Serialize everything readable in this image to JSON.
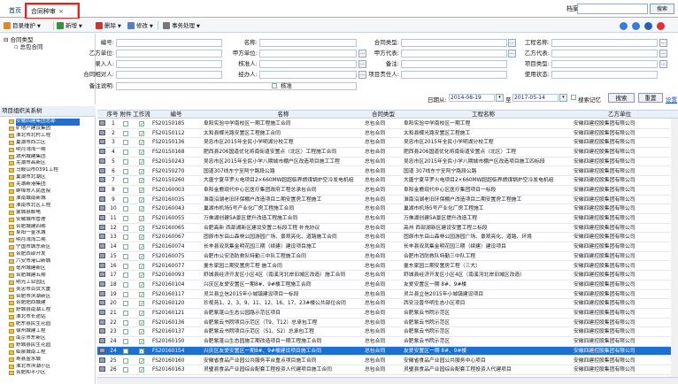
{
  "tabs": {
    "home": "首页",
    "contract": "合同种审"
  },
  "top": {
    "archive_label": "档案",
    "search_button": "搜索"
  },
  "toolbar": {
    "catalog": "目录维护",
    "add": "新增",
    "delete": "删除",
    "edit": "修改",
    "workflow": "事务处理",
    "dropdown_mark": "▼"
  },
  "tree": {
    "root": "合同类型",
    "child": "总包合同"
  },
  "form": {
    "labels": {
      "code": "编号:",
      "name": "名称:",
      "type": "合同类型:",
      "project_code": "工程名称:",
      "party_a": "乙方单位:",
      "party_a2": "甲方单位:",
      "party_a_rep": "甲方代表:",
      "party_b_rep": "乙方代表:",
      "entry": "录入人:",
      "approver": "核准人:",
      "remark": "备注:",
      "project_type": "项目类型:",
      "contract_unit": "合同相对人:",
      "handler": "经办人:",
      "project_manager": "项目责任人:",
      "use_status": "使用状态:",
      "remarks": "备注说明:",
      "approved": "核准"
    },
    "date_label": "日期从:",
    "date_from": "2014-08-19",
    "date_to_label": "至",
    "date_to": "2017-05-14",
    "remember_label": "搜索记忆",
    "search_button": "搜索",
    "reset_button": "重置",
    "settings_link": "设置"
  },
  "left_panel": {
    "header": "项目组织关系树",
    "items": [
      "安徽四建集团总部",
      "矿地产建设集团",
      "淮北市北村工程",
      "巢湖市西二区",
      "明月湾湾一期",
      "滁州城建集团",
      "芜湖市高新区",
      "马鞍山市0391工程",
      "巢湖市北湖区",
      "芜湖新港集团",
      "蚌埠市人民医院",
      "淮南城南新城",
      "淮南市北区工程",
      "蒙城县邮电",
      "安徽城市管理",
      "合肥城建四期",
      "阜阳一金水城",
      "明月湾湾二期",
      "宁国市城东新区",
      "合肥西部开发",
      "六安市港口新城",
      "亳州城建新区",
      "合肥城建五期",
      "明光工业园区",
      "吴忠市百货大厦",
      "合肥市滨湖新区",
      "合肥肥西城建",
      "舒城县南湖工程",
      "淮北市长途站",
      "肥东县民生花园",
      "宿州城建工程",
      "南京市东新区",
      "舒城县民生花园",
      "临泉城南工程",
      "寿县金水城",
      "淮北市滨湖小区",
      "合肥和平小区"
    ]
  },
  "grid": {
    "headers": [
      "序号",
      "附件",
      "工作流",
      "编号",
      "名称",
      "合同类型",
      "工程名称",
      "乙方单位"
    ],
    "rows": [
      {
        "no": "1",
        "att": false,
        "wf": true,
        "code": "FS20150185",
        "name": "阜阳实验中学南校区一期工程施工合同",
        "type": "总包合同",
        "project": "阜阳实验中学南校区一期工程",
        "party": "安徽四建控股集团有限公司"
      },
      {
        "no": "2",
        "att": false,
        "wf": true,
        "code": "FS20150112",
        "name": "太和县蝶光路安置区工程施工合同",
        "type": "总包合同",
        "project": "太和县蝶光路安置区工程施工",
        "party": "安徽四建控股集团有限公司"
      },
      {
        "no": "3",
        "att": false,
        "wf": true,
        "code": "FS20150136",
        "name": "吴忠市区2015年全民小学明湖分校工程",
        "type": "总包合同",
        "project": "吴忠市区2015年全民小学明湖分校工程",
        "party": "安徽四建控股集团有限公司"
      },
      {
        "no": "4",
        "att": false,
        "wf": true,
        "code": "FS20150168",
        "name": "肥西县206国道优化将南街道安置点（北区）工程施工合同",
        "type": "总包合同",
        "project": "肥西县206国道优化将南街道安置点（北区）工程",
        "party": "安徽四建控股集团有限公司"
      },
      {
        "no": "5",
        "att": false,
        "wf": true,
        "code": "FS20150243",
        "name": "吴忠市区2015年全民小学八期城市棚户区改造项目施工工程",
        "type": "总包合同",
        "project": "吴忠市区2015年全民小学八期城市棚户区改造项目施工四标段",
        "party": "安徽四建控股集团有限公司"
      },
      {
        "no": "6",
        "att": false,
        "wf": true,
        "code": "FS20150270",
        "name": "国道307线东宁至阿宁路段公路",
        "type": "总包合同",
        "project": "国道 307线东宁至阿宁路段公路",
        "party": "安徽四建控股集团有限公司"
      },
      {
        "no": "7",
        "att": false,
        "wf": true,
        "code": "FS20150260",
        "name": "大唐宁夏平罗火电项目2×660MW超超临界燃煤锅炉空冷发电机组",
        "type": "总包合同",
        "project": "大唐宁夏平罗火电项目2×660MW超超临界燃煤锅炉空冷发电机组",
        "party": "安徽四建控股集团有限公司"
      },
      {
        "no": "8",
        "att": false,
        "wf": true,
        "code": "FS20160003",
        "name": "阜阳金鹿现代中心区医疗集团政府工程总承包合同",
        "type": "总包合同",
        "project": "阜阳金鹿现代中心区医疗集团项目一标段",
        "party": "安徽四建控股集团有限公司"
      },
      {
        "no": "9",
        "att": false,
        "wf": true,
        "code": "FS20160035",
        "name": "淮南沿湖老旧环保棚户改造项目二期安置房工程施工",
        "type": "总包合同",
        "project": "淮南沿湖老旧环保棚户改造项目二期安置房工程施工",
        "party": "安徽四建控股集团有限公司"
      },
      {
        "no": "10",
        "att": false,
        "wf": true,
        "code": "FS20160043",
        "name": "巢湖市机场5号产业化厂房工程施工合同",
        "type": "总包合同",
        "project": "巢湖市机场5号产业化厂房工程施工",
        "party": "安徽四建控股集团有限公司"
      },
      {
        "no": "11",
        "att": false,
        "wf": true,
        "code": "FS20160055",
        "name": "万佛湖创建5A景区提升改造工程施工合同",
        "type": "总包合同",
        "project": "万佛湖创建5A景区提升改造工程",
        "party": "安徽四建控股集团有限公司"
      },
      {
        "no": "12",
        "att": false,
        "wf": true,
        "code": "FS20160065",
        "name": "合肥高新 西部湖新区建设安置二标段工程 补充协议",
        "type": "总包合同",
        "project": "高州 西部湖新区建设安置工程二标段",
        "party": "安徽四建控股集团有限公司"
      },
      {
        "no": "13",
        "att": false,
        "wf": true,
        "code": "FS20160067",
        "name": "固原市东岳山森林公园游园广场、景观亮化、道路施工合同",
        "type": "总包合同",
        "project": "固原市东岳山森林公园游园广场、景观亮化、道路、环境",
        "party": "安徽四建控股集团有限公司"
      },
      {
        "no": "14",
        "att": false,
        "wf": true,
        "code": "FS20160074",
        "name": "长丰县双凤集金明花园三期（续建）建设项目施工",
        "type": "总包合同",
        "project": "长丰县双凤集金明花园三期（续建）建设项目",
        "party": "安徽四建控股集团有限公司"
      },
      {
        "no": "15",
        "att": false,
        "wf": true,
        "code": "FS20160075",
        "name": "合肥市公安消防救队特勤三中队工程施工合同",
        "type": "总包合同",
        "project": "合肥市消防救队特勤三中队工程",
        "party": "安徽四建控股集团有限公司"
      },
      {
        "no": "16",
        "att": false,
        "wf": true,
        "code": "FS20160077",
        "name": "羹东家园二期安置房工程 施工合同",
        "type": "总包合同",
        "project": "羹东家园二期安置房工程（三大）",
        "party": "安徽四建控股集团有限公司"
      },
      {
        "no": "17",
        "att": false,
        "wf": true,
        "code": "FS20160093",
        "name": "舒城县经济开发区小区4区（南溪河北岸旧城区改造）施工合同",
        "type": "总包合同",
        "project": "舒城县经济开发区小区4区（南溪河北岸旧城区改造）",
        "party": "安徽四建控股集团有限公司"
      },
      {
        "no": "18",
        "att": false,
        "wf": true,
        "code": "FS20160104",
        "name": "兴庆区友爱安置区一期8#、9#楼工程施工合同",
        "type": "总包合同",
        "project": "友爱安置区一期 8#、9#楼",
        "party": "安徽四建控股集团有限公司"
      },
      {
        "no": "19",
        "att": false,
        "wf": true,
        "code": "FS20160117",
        "name": "灵兰县立信2015年小城镇建设项目一标段",
        "type": "总包合同",
        "project": "灵兰县立信2015年小城镇建设项目",
        "party": "安徽四建控股集团有限公司"
      },
      {
        "no": "20",
        "att": false,
        "wf": true,
        "code": "FS20160120",
        "name": "珍视苑1、2、3、9、11、12、16、17、23#楼公共部位合同",
        "type": "总包合同",
        "project": "西安泾晋华明生态小区项目",
        "party": "安徽四建控股集团有限公司"
      },
      {
        "no": "21",
        "att": false,
        "wf": true,
        "code": "FS20160121",
        "name": "合肥紫蓬山生态公园路示范区项目",
        "type": "总包合同",
        "project": "合肥紫云书院示范区",
        "party": "安徽四建控股集团有限公司"
      },
      {
        "no": "22",
        "att": false,
        "wf": true,
        "code": "FS20160136",
        "name": "合肥紫云书院项目示范区（T9、T12）总承包工程",
        "type": "总包合同",
        "project": "合肥紫云书院示范区",
        "party": "安徽四建控股集团有限公司"
      },
      {
        "no": "23",
        "att": false,
        "wf": true,
        "code": "FS20160137",
        "name": "合肥紫云书院项目示范区（S1、S2）总承包工程",
        "type": "总包合同",
        "project": "合肥紫云书院示范区",
        "party": "安徽四建控股集团有限公司"
      },
      {
        "no": "24",
        "att": false,
        "wf": true,
        "code": "FS20160150",
        "name": "合肥紫蓬山生态园施工期改造项目一期工程施工合同",
        "type": "总包合同",
        "project": "合肥紫云书院示范区",
        "party": "安徽四建控股集团有限公司"
      },
      {
        "no": "24",
        "att": false,
        "wf": true,
        "code": "FS20160154",
        "name": "兴庆区友爱安置区一期8#、9#楼建设项目施工合同",
        "type": "总包合同",
        "project": "友爱安置区一期 8#、9#楼",
        "party": "安徽四建控股集团有限公司",
        "selected": true
      },
      {
        "no": "25",
        "att": false,
        "wf": true,
        "code": "FS20160160",
        "name": "安徽省食品产业园公共服务平台重点项目施工合同",
        "type": "总包合同",
        "project": "安徽省食品产业园公共服务中心项目",
        "party": "安徽四建控股集团有限公司"
      },
      {
        "no": "26",
        "att": false,
        "wf": true,
        "code": "FS20160163",
        "name": "灵璧县食品产业园综合配套工程投资人代建项目施工合同",
        "type": "总包合同",
        "project": "灵璧县食品产业园综合配套工程投资人代建项目",
        "party": "安徽四建控股集团有限公司"
      }
    ]
  },
  "colors": {
    "selected_row": "#1f6fd0",
    "tab_highlight": "#e3241b",
    "folder": "#e6c259"
  }
}
